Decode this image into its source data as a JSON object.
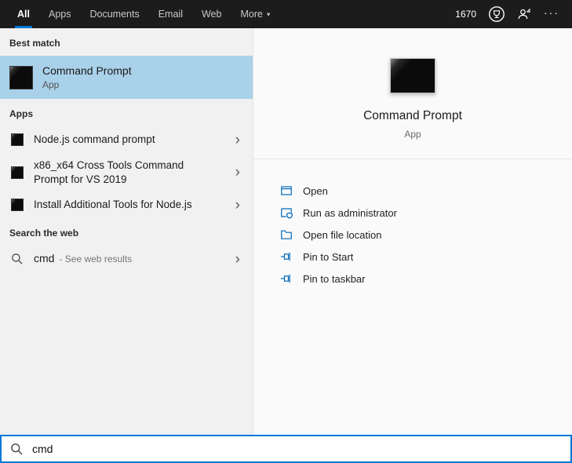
{
  "topbar": {
    "tabs": [
      {
        "label": "All"
      },
      {
        "label": "Apps"
      },
      {
        "label": "Documents"
      },
      {
        "label": "Email"
      },
      {
        "label": "Web"
      },
      {
        "label": "More"
      }
    ],
    "counter": "1670"
  },
  "icons": {
    "caret": "▾",
    "chevron": "›",
    "ellipsis": "···"
  },
  "left_panel": {
    "best_match_header": "Best match",
    "best_match": {
      "title": "Command Prompt",
      "subtitle": "App"
    },
    "apps_header": "Apps",
    "apps": [
      {
        "title": "Node.js command prompt"
      },
      {
        "title": "x86_x64 Cross Tools Command Prompt for VS 2019"
      },
      {
        "title": "Install Additional Tools for Node.js"
      }
    ],
    "web_header": "Search the web",
    "web_item": {
      "query": "cmd",
      "suffix": "- See web results"
    }
  },
  "preview": {
    "title": "Command Prompt",
    "subtitle": "App",
    "actions": [
      {
        "label": "Open"
      },
      {
        "label": "Run as administrator"
      },
      {
        "label": "Open file location"
      },
      {
        "label": "Pin to Start"
      },
      {
        "label": "Pin to taskbar"
      }
    ]
  },
  "search_box": {
    "value": "cmd"
  },
  "colors": {
    "accent": "#0078d7",
    "selected_bg": "#a9d1ea",
    "topbar_bg": "#1c1c1c",
    "left_bg": "#f2f1f1",
    "right_bg": "#fafafa"
  }
}
